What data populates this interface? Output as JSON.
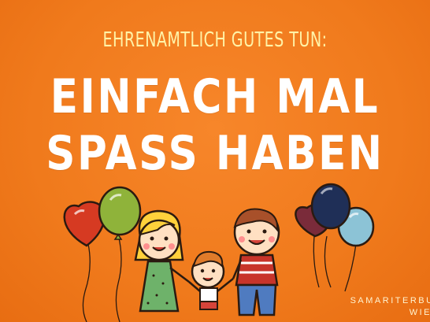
{
  "poster": {
    "kicker": "EHRENAMTLICH GUTES TUN:",
    "headline_line1": "EINFACH MAL",
    "headline_line2": "SPASS HABEN",
    "brand_line1": "SAMARITERBUN",
    "brand_line2": "WIE"
  },
  "colors": {
    "background": "#f07a1c",
    "kicker": "#fff3a8",
    "headline": "#ffffff"
  },
  "illustration": {
    "figures": [
      "girl",
      "boy",
      "man"
    ],
    "balloon_colors_left": [
      "#d93a24",
      "#8fb33a"
    ],
    "balloon_colors_right": [
      "#7a2b3a",
      "#1f2f57",
      "#8cc3d6"
    ]
  }
}
